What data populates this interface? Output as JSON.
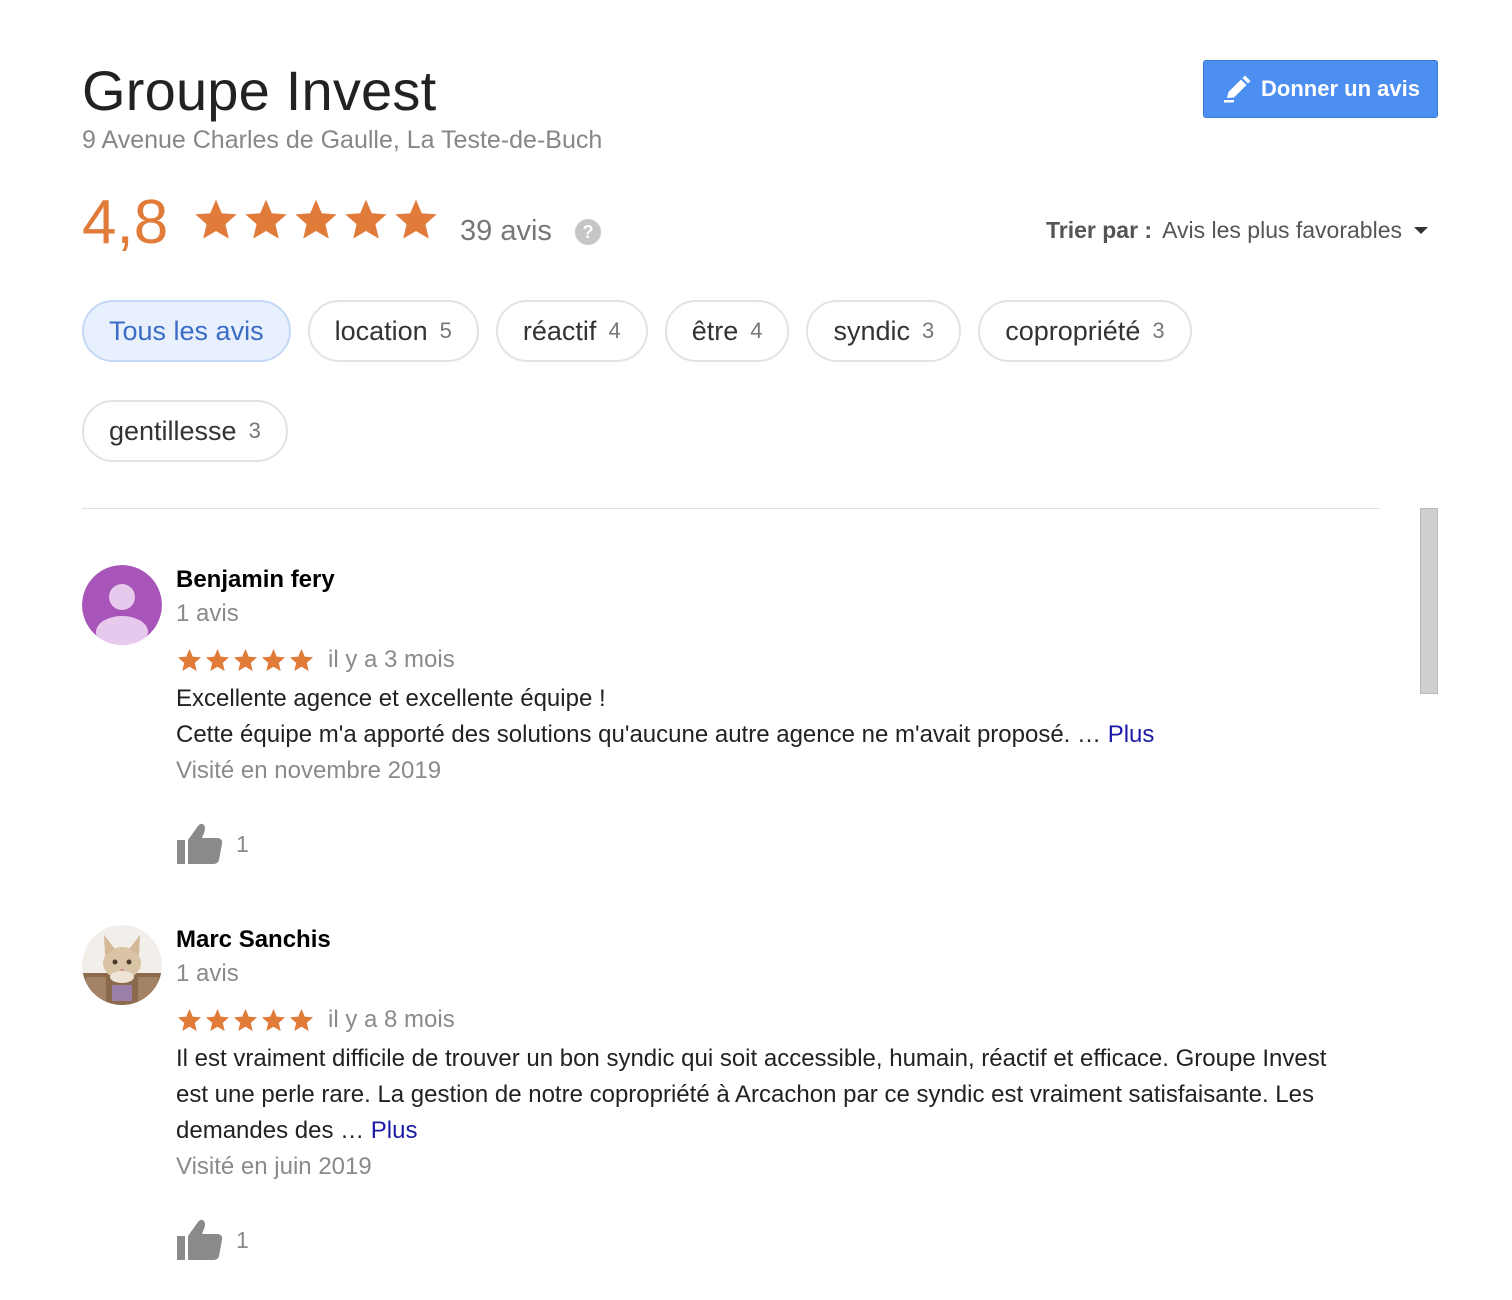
{
  "header": {
    "title": "Groupe Invest",
    "address": "9 Avenue Charles de Gaulle, La Teste-de-Buch",
    "write_review_label": "Donner un avis"
  },
  "summary": {
    "rating": "4,8",
    "stars_filled": 5,
    "review_count_label": "39 avis",
    "help_glyph": "?",
    "accent_color": "#e07b39"
  },
  "sort": {
    "label": "Trier par :",
    "value": "Avis les plus favorables"
  },
  "chips": [
    {
      "label": "Tous les avis",
      "count": "",
      "active": true
    },
    {
      "label": "location",
      "count": "5",
      "active": false
    },
    {
      "label": "réactif",
      "count": "4",
      "active": false
    },
    {
      "label": "être",
      "count": "4",
      "active": false
    },
    {
      "label": "syndic",
      "count": "3",
      "active": false
    },
    {
      "label": "copropriété",
      "count": "3",
      "active": false
    },
    {
      "label": "gentillesse",
      "count": "3",
      "active": false
    }
  ],
  "reviews": [
    {
      "author": "Benjamin fery",
      "author_reviews": "1 avis",
      "avatar": "person-avatar-icon",
      "stars": 5,
      "date": "il y a 3 mois",
      "text_lines": [
        "Excellente agence et excellente équipe !",
        "Cette équipe m'a apporté des solutions qu'aucune autre agence ne m'avait proposé. … "
      ],
      "more_label": "Plus",
      "visit": "Visité en novembre 2019",
      "likes": "1"
    },
    {
      "author": "Marc Sanchis",
      "author_reviews": "1 avis",
      "avatar": "cat-photo-avatar",
      "stars": 5,
      "date": "il y a 8 mois",
      "text_lines": [
        "Il est vraiment difficile de trouver un bon syndic qui soit accessible, humain, réactif et efficace. Groupe Invest est une perle rare. La gestion de notre copropriété à Arcachon par ce syndic est vraiment satisfaisante. Les demandes des … "
      ],
      "more_label": "Plus",
      "visit": "Visité en juin 2019",
      "likes": "1"
    }
  ]
}
